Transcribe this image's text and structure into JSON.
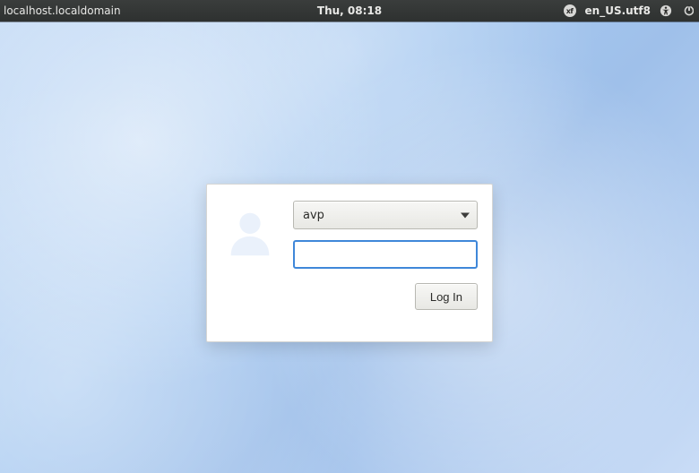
{
  "topbar": {
    "hostname": "localhost.localdomain",
    "clock": "Thu, 08:18",
    "lang": "en_US.utf8"
  },
  "login": {
    "selected_user": "avp",
    "password_value": "",
    "login_label": "Log In"
  }
}
